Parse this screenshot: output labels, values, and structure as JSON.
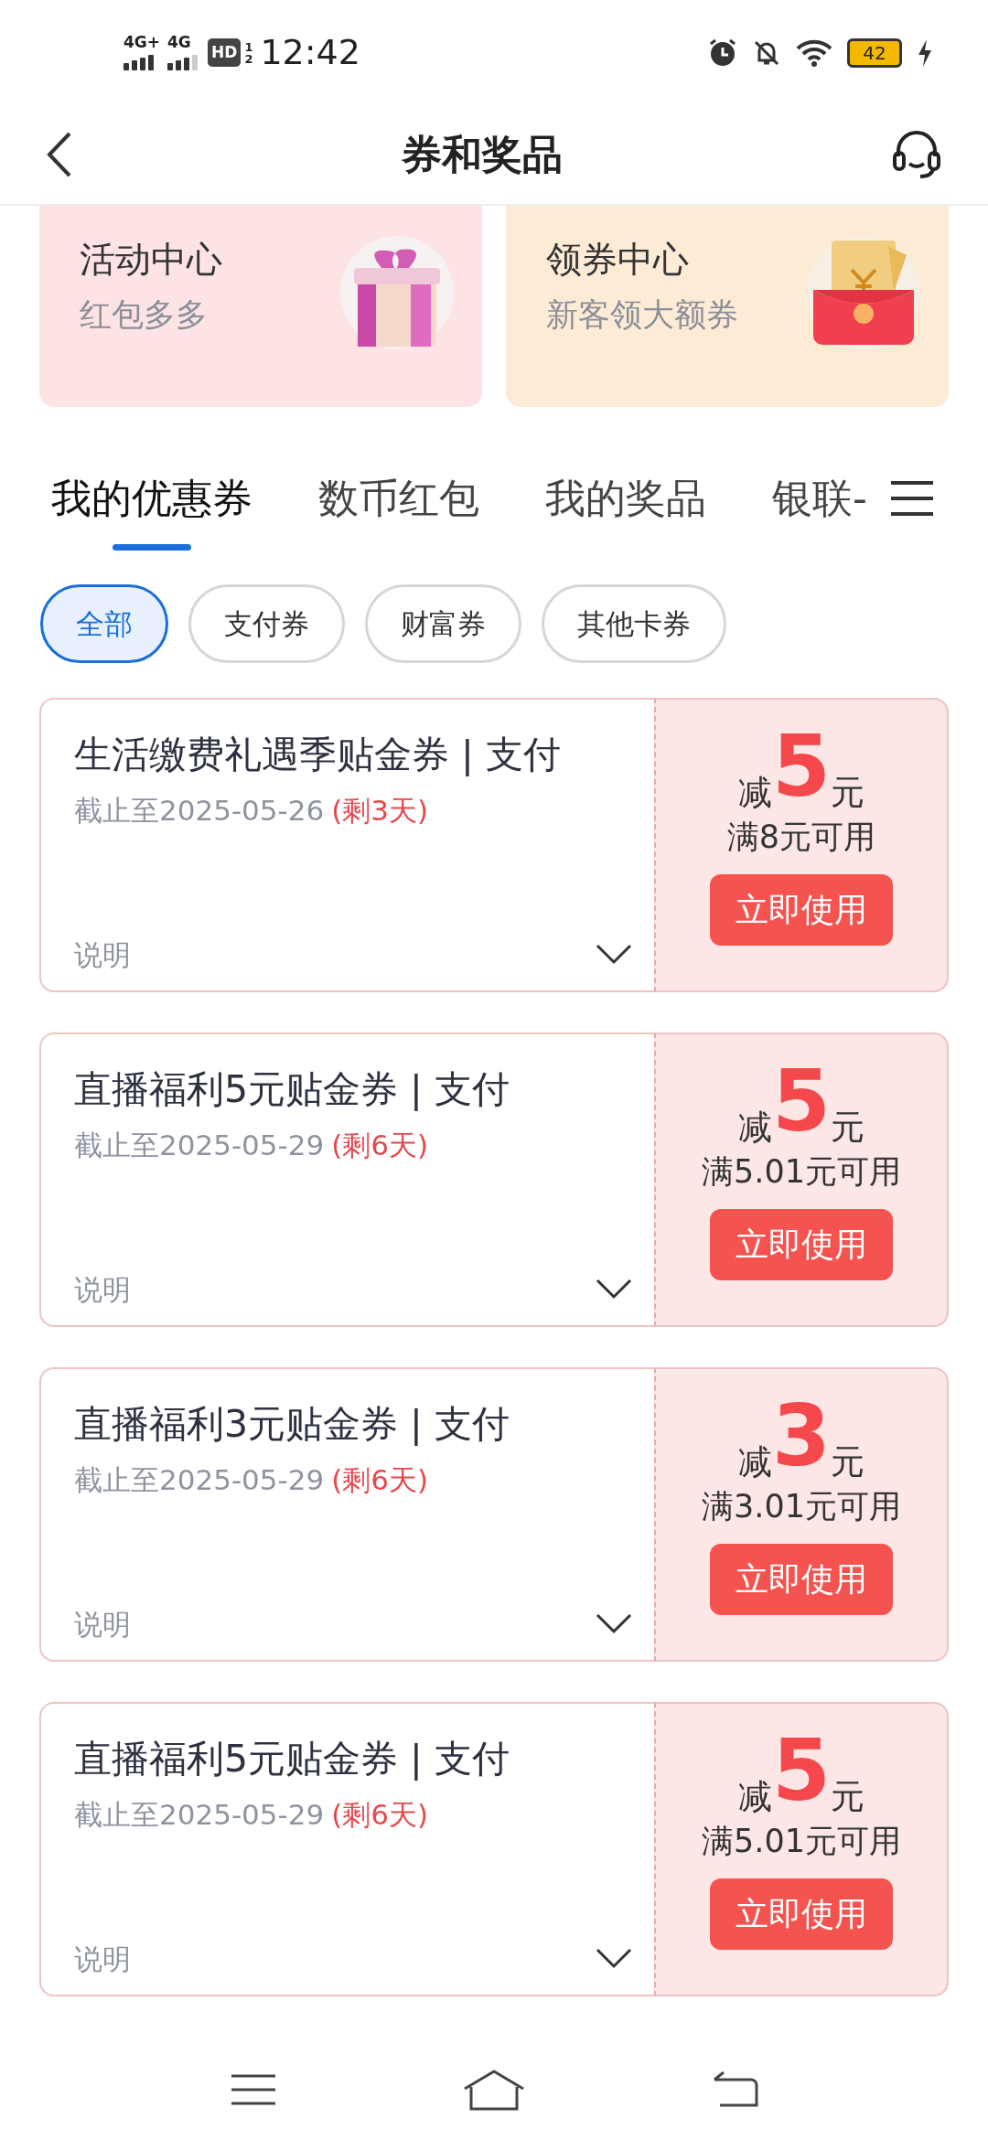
{
  "status_bar": {
    "signals": [
      "4G+",
      "4G"
    ],
    "hd_label": "HD",
    "hd_slots": [
      "1",
      "2"
    ],
    "time": "12:42",
    "battery": "42"
  },
  "header": {
    "title": "券和奖品"
  },
  "entry_cards": [
    {
      "title": "活动中心",
      "subtitle": "红包多多",
      "kind": "gift"
    },
    {
      "title": "领券中心",
      "subtitle": "新客领大额券",
      "kind": "envelope"
    }
  ],
  "tabs": [
    {
      "label": "我的优惠券",
      "selected": true
    },
    {
      "label": "数币红包",
      "selected": false
    },
    {
      "label": "我的奖品",
      "selected": false
    },
    {
      "label": "银联-",
      "selected": false
    }
  ],
  "filters": [
    {
      "label": "全部",
      "selected": true
    },
    {
      "label": "支付券",
      "selected": false
    },
    {
      "label": "财富券",
      "selected": false
    },
    {
      "label": "其他卡券",
      "selected": false
    }
  ],
  "coupons": [
    {
      "title": "生活缴费礼遇季贴金券 | 支付",
      "expiry": "截止至2025-05-26",
      "remaining": "(剩3天)",
      "note": "说明",
      "expanded": false,
      "prefix": "减",
      "amount": "5",
      "unit": "元",
      "condition": "满8元可用",
      "button": "立即使用"
    },
    {
      "title": "直播福利5元贴金券 | 支付",
      "expiry": "截止至2025-05-29",
      "remaining": "(剩6天)",
      "note": "说明",
      "expanded": false,
      "prefix": "减",
      "amount": "5",
      "unit": "元",
      "condition": "满5.01元可用",
      "button": "立即使用"
    },
    {
      "title": "直播福利3元贴金券 | 支付",
      "expiry": "截止至2025-05-29",
      "remaining": "(剩6天)",
      "note": "说明",
      "expanded": false,
      "prefix": "减",
      "amount": "3",
      "unit": "元",
      "condition": "满3.01元可用",
      "button": "立即使用"
    },
    {
      "title": "直播福利5元贴金券 | 支付",
      "expiry": "截止至2025-05-29",
      "remaining": "(剩6天)",
      "note": "说明",
      "expanded": false,
      "prefix": "减",
      "amount": "5",
      "unit": "元",
      "condition": "满5.01元可用",
      "button": "立即使用"
    }
  ]
}
